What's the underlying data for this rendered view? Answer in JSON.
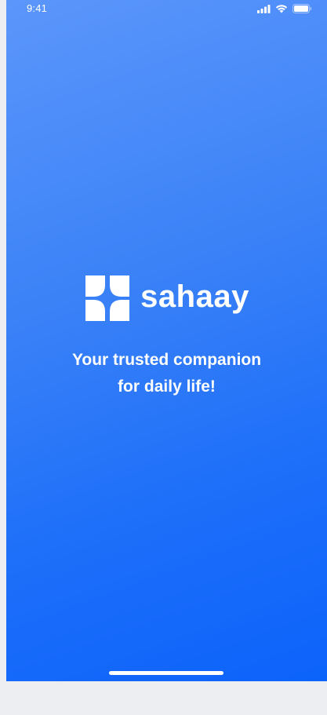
{
  "status_bar": {
    "time": "9:41",
    "icons": [
      "signal-icon",
      "wifi-icon",
      "battery-icon"
    ]
  },
  "brand": {
    "name": "sahaay",
    "logo": "sahaay-logo-icon"
  },
  "tagline": {
    "line1": "Your trusted companion",
    "line2": "for daily life!"
  },
  "colors": {
    "gradient_start": "#5b96fb",
    "gradient_end": "#0c63fb",
    "text": "#ffffff",
    "page_background": "#eceef1"
  }
}
